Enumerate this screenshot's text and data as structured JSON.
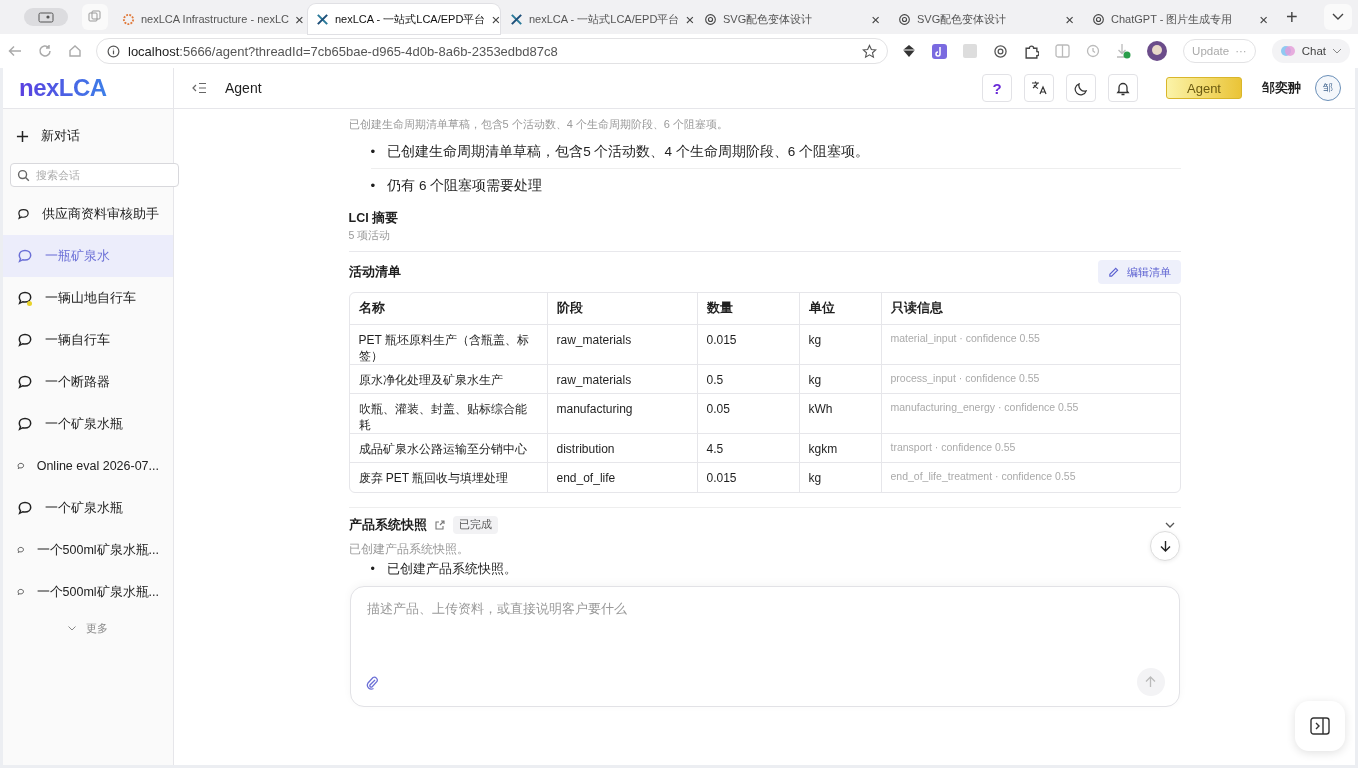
{
  "browser": {
    "tabs": [
      {
        "title": "nexLCA Infrastructure - nexLC",
        "selected": false
      },
      {
        "title": "nexLCA - 一站式LCA/EPD平台",
        "selected": true
      },
      {
        "title": "nexLCA - 一站式LCA/EPD平台",
        "selected": false
      },
      {
        "title": "SVG配色变体设计",
        "selected": false
      },
      {
        "title": "SVG配色变体设计",
        "selected": false
      },
      {
        "title": "ChatGPT - 图片生成专用",
        "selected": false
      }
    ],
    "close_mark": "×",
    "new_tab": "+",
    "address_host": "localhost",
    "address_rest": ":5666/agent?threadId=7cb65bae-d965-4d0b-8a6b-2353edbd87c8",
    "update_button": "Update",
    "update_more": "···",
    "chat_button": "Chat"
  },
  "sidebar": {
    "logo": "nexLCA",
    "new_chat": "新对话",
    "search": {
      "placeholder": "搜索会话"
    },
    "conversations": [
      {
        "title": "供应商资料审核助手",
        "selected": false,
        "unread": false
      },
      {
        "title": "一瓶矿泉水",
        "selected": true,
        "unread": false
      },
      {
        "title": "一辆山地自行车",
        "selected": false,
        "unread": true
      },
      {
        "title": "一辆自行车",
        "selected": false,
        "unread": false
      },
      {
        "title": "一个断路器",
        "selected": false,
        "unread": false
      },
      {
        "title": "一个矿泉水瓶",
        "selected": false,
        "unread": false
      },
      {
        "title": "Online eval 2026-07...",
        "selected": false,
        "unread": false
      },
      {
        "title": "一个矿泉水瓶",
        "selected": false,
        "unread": false
      },
      {
        "title": "一个500ml矿泉水瓶...",
        "selected": false,
        "unread": false
      },
      {
        "title": "一个500ml矿泉水瓶...",
        "selected": false,
        "unread": false
      }
    ],
    "more": "更多"
  },
  "header": {
    "title": "Agent",
    "help": "?",
    "agent_button": "Agent",
    "user_name": "邹奕翀",
    "avatar": "邹"
  },
  "thread": {
    "bullet_mark": "•",
    "summary": "已创建生命周期清单草稿，包含5 个活动数、4 个生命周期阶段、6 个阻塞项。",
    "bullets": [
      "已创建生命周期清单草稿，包含5 个活动数、4 个生命周期阶段、6 个阻塞项。",
      "仍有 6 个阻塞项需要处理"
    ],
    "lci": {
      "title": "LCI 摘要",
      "subtitle": "5 项活动"
    },
    "activities": {
      "title": "活动清单",
      "edit_button": "编辑清单",
      "columns": [
        "名称",
        "阶段",
        "数量",
        "单位",
        "只读信息"
      ],
      "rows": [
        [
          "PET 瓶坯原料生产（含瓶盖、标签）",
          "raw_materials",
          "0.015",
          "kg",
          "material_input · confidence 0.55"
        ],
        [
          "原水净化处理及矿泉水生产",
          "raw_materials",
          "0.5",
          "kg",
          "process_input · confidence 0.55"
        ],
        [
          "吹瓶、灌装、封盖、贴标综合能耗",
          "manufacturing",
          "0.05",
          "kWh",
          "manufacturing_energy · confidence 0.55"
        ],
        [
          "成品矿泉水公路运输至分销中心",
          "distribution",
          "4.5",
          "kgkm",
          "transport · confidence 0.55"
        ],
        [
          "废弃 PET 瓶回收与填埋处理",
          "end_of_life",
          "0.015",
          "kg",
          "end_of_life_treatment · confidence 0.55"
        ]
      ]
    },
    "snapshot": {
      "title": "产品系统快照",
      "status": "已完成",
      "expanded": false,
      "description": "已创建产品系统快照。",
      "bullets": [
        "已创建产品系统快照。"
      ]
    }
  },
  "composer": {
    "placeholder": "描述产品、上传资料，或直接说明客户要什么"
  }
}
